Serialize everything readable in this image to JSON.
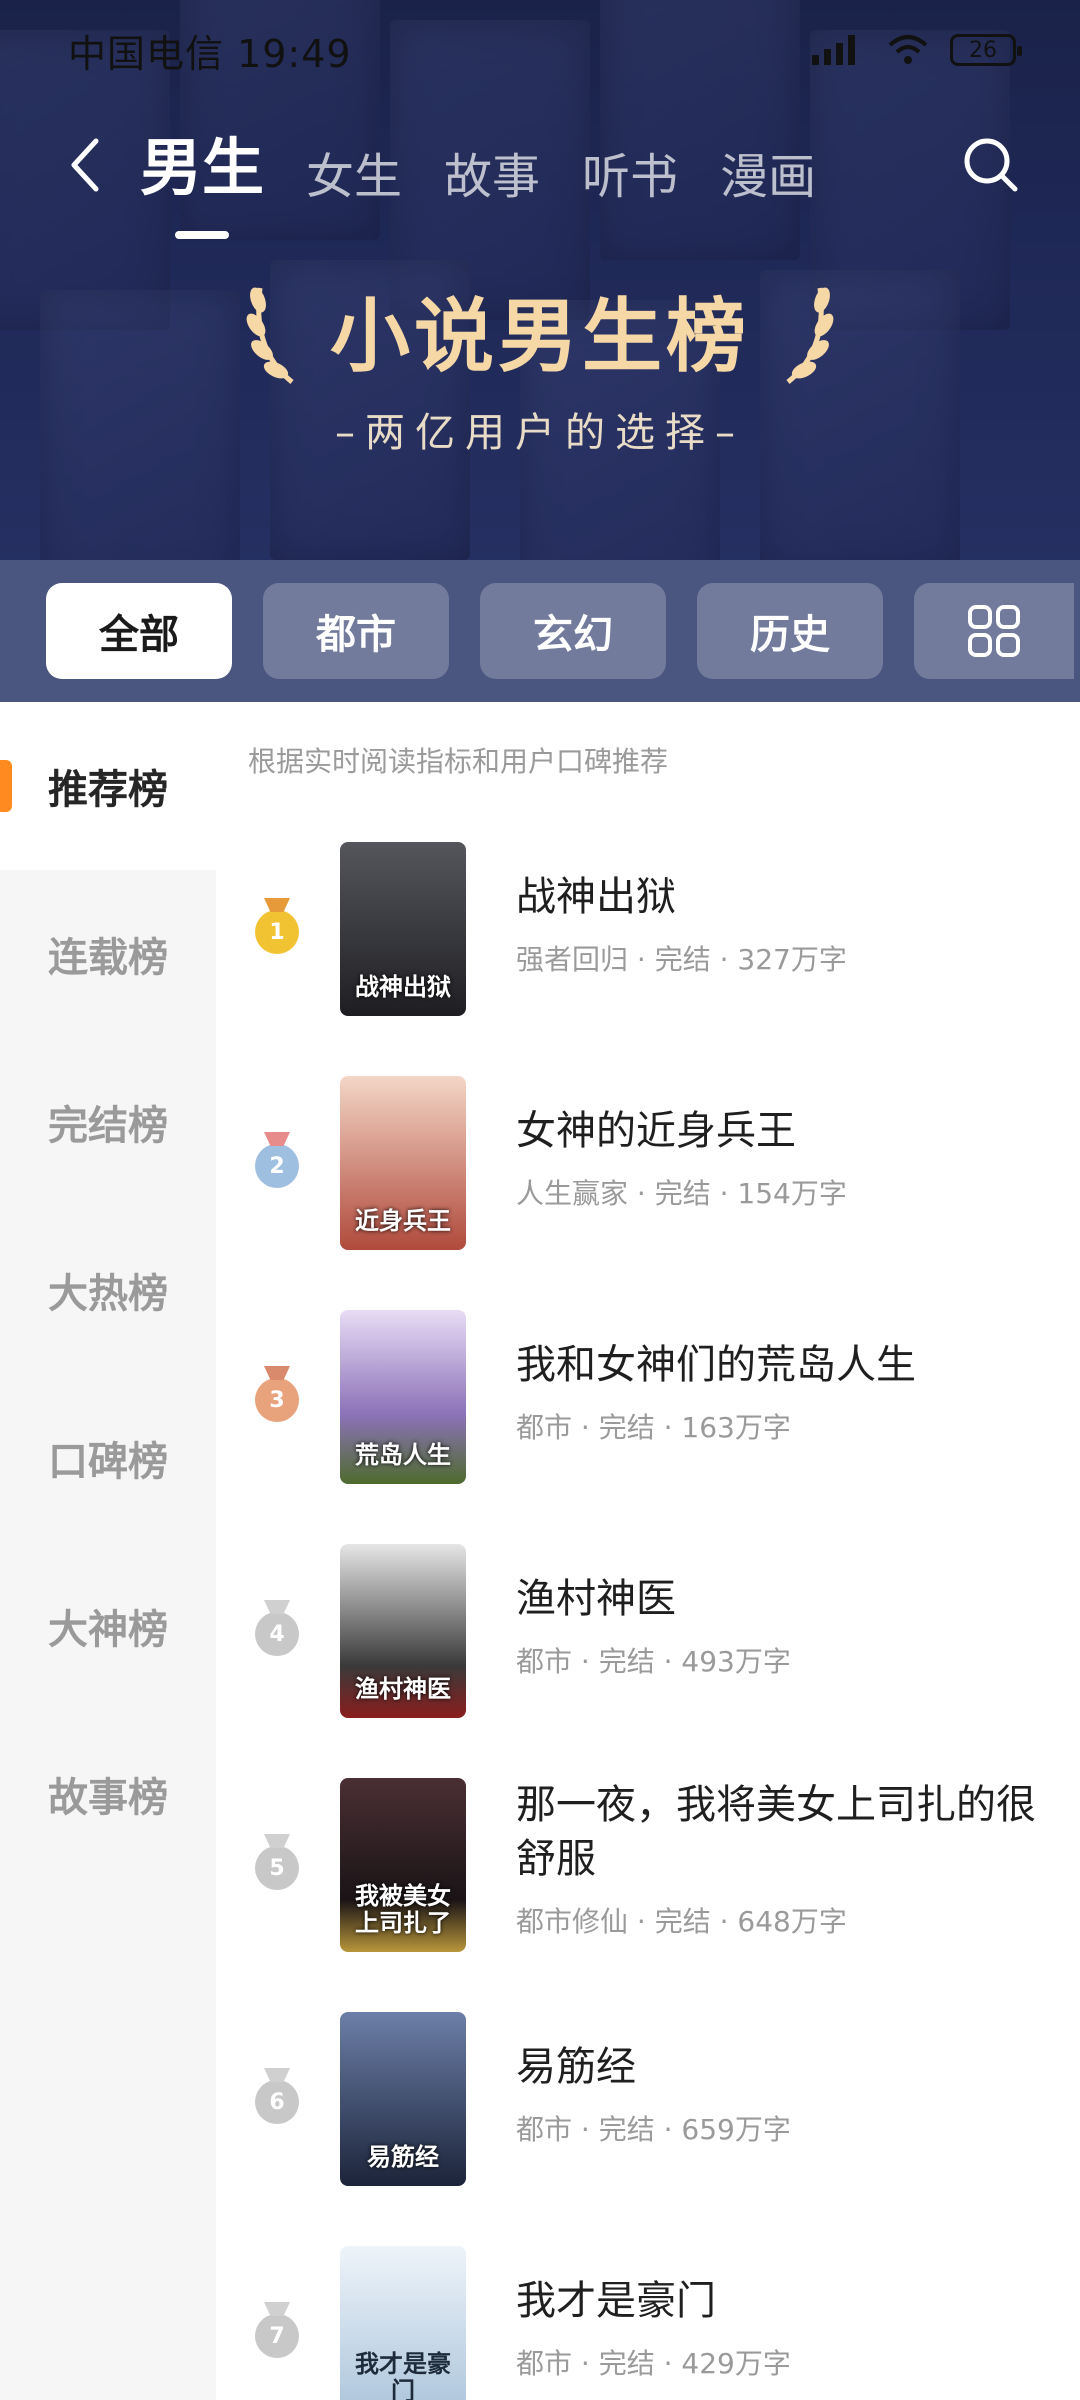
{
  "status_bar": {
    "carrier_time": "中国电信 19:49",
    "battery": "26"
  },
  "nav": {
    "tabs": [
      {
        "label": "男生",
        "active": true
      },
      {
        "label": "女生",
        "active": false
      },
      {
        "label": "故事",
        "active": false
      },
      {
        "label": "听书",
        "active": false
      },
      {
        "label": "漫画",
        "active": false
      }
    ]
  },
  "hero": {
    "title": "小说男生榜",
    "subtitle": "–两亿用户的选择–"
  },
  "categories": [
    {
      "label": "全部",
      "active": true
    },
    {
      "label": "都市",
      "active": false
    },
    {
      "label": "玄幻",
      "active": false
    },
    {
      "label": "历史",
      "active": false
    }
  ],
  "sidebar": {
    "items": [
      {
        "label": "推荐榜",
        "active": true
      },
      {
        "label": "连载榜",
        "active": false
      },
      {
        "label": "完结榜",
        "active": false
      },
      {
        "label": "大热榜",
        "active": false
      },
      {
        "label": "口碑榜",
        "active": false
      },
      {
        "label": "大神榜",
        "active": false
      },
      {
        "label": "故事榜",
        "active": false
      }
    ]
  },
  "list": {
    "hint": "根据实时阅读指标和用户口碑推荐",
    "books": [
      {
        "rank": "1",
        "title": "战神出狱",
        "meta": "强者回归 · 完结 · 327万字",
        "cover_text": "战神出狱",
        "cover_color": "#2a2a2e"
      },
      {
        "rank": "2",
        "title": "女神的近身兵王",
        "meta": "人生赢家 · 完结 · 154万字",
        "cover_text": "近身兵王",
        "cover_color": "#c9876a"
      },
      {
        "rank": "3",
        "title": "我和女神们的荒岛人生",
        "meta": "都市 · 完结 · 163万字",
        "cover_text": "荒岛人生",
        "cover_color": "#9a86c9"
      },
      {
        "rank": "4",
        "title": "渔村神医",
        "meta": "都市 · 完结 · 493万字",
        "cover_text": "渔村神医",
        "cover_color": "#4a4a4a"
      },
      {
        "rank": "5",
        "title": "那一夜，我将美女上司扎的很舒服",
        "meta": "都市修仙 · 完结 · 648万字",
        "cover_text": "我被美女上司扎了",
        "cover_color": "#3a2a2e"
      },
      {
        "rank": "6",
        "title": "易筋经",
        "meta": "都市 · 完结 · 659万字",
        "cover_text": "易筋经",
        "cover_color": "#23304a"
      },
      {
        "rank": "7",
        "title": "我才是豪门",
        "meta": "都市 · 完结 · 429万字",
        "cover_text": "我才是豪门",
        "cover_color": "#cfe0ee"
      }
    ]
  },
  "colors": {
    "accent": "#ff8a1f",
    "gold": "#f1c232",
    "silver": "#9fbfe0",
    "bronze": "#e8a27c",
    "plain_rank": "#c8c8c8"
  }
}
